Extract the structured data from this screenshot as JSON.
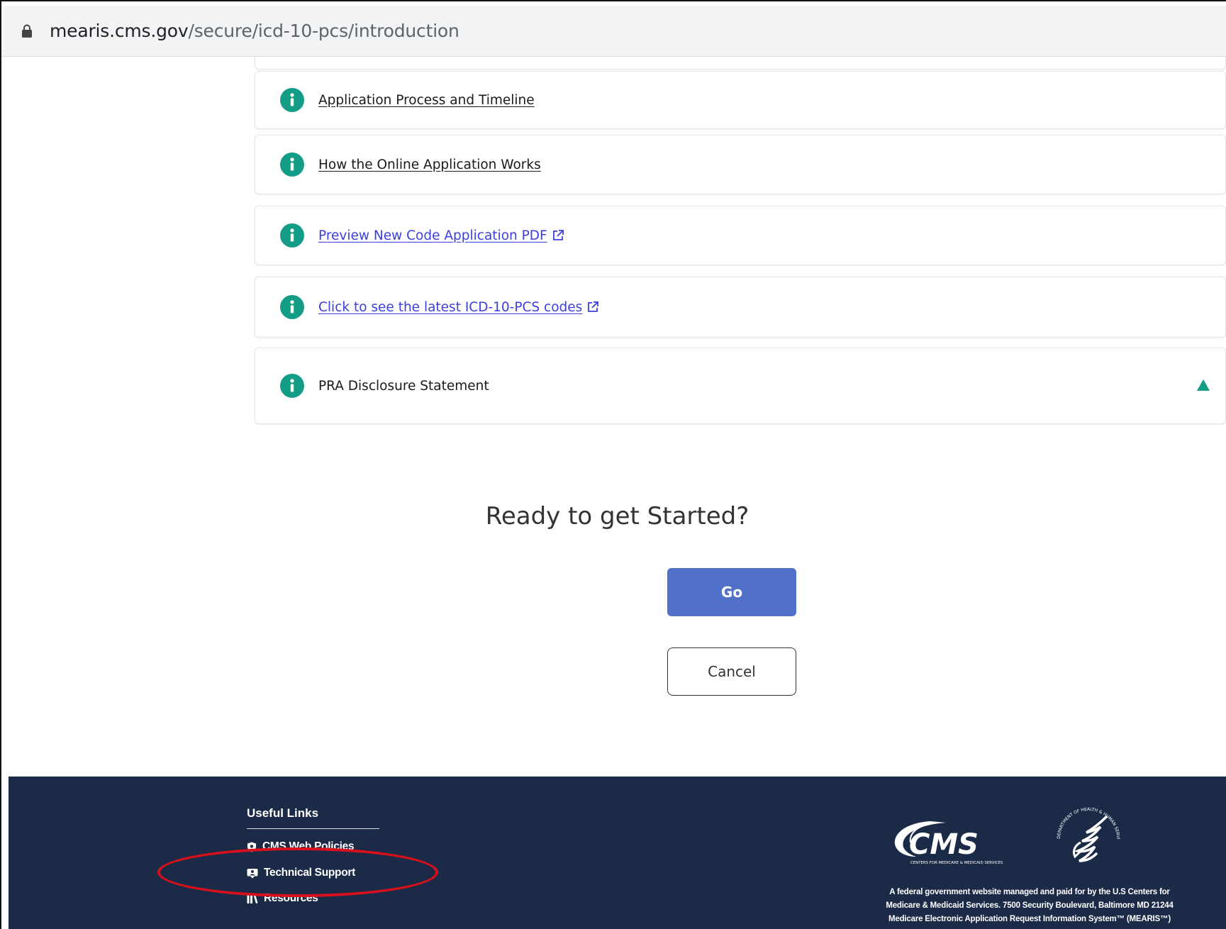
{
  "browser": {
    "url_host": "mearis.cms.gov",
    "url_path": "/secure/icd-10-pcs/introduction"
  },
  "accordion": {
    "items": [
      {
        "label": "Application Process and Timeline"
      },
      {
        "label": "How the Online Application Works"
      },
      {
        "label": "Preview New Code Application PDF"
      },
      {
        "label": "Click to see the latest ICD-10-PCS codes"
      },
      {
        "label": "PRA Disclosure Statement"
      }
    ]
  },
  "cta": {
    "heading": "Ready to get Started?",
    "go_label": "Go",
    "cancel_label": "Cancel"
  },
  "footer": {
    "useful_links_title": "Useful Links",
    "links": [
      {
        "label": "CMS Web Policies",
        "icon": "shield-icon"
      },
      {
        "label": "Technical Support",
        "icon": "support-icon"
      },
      {
        "label": "Resources",
        "icon": "books-icon"
      }
    ],
    "logo_text": "CMS",
    "logo_subtext": "CENTERS FOR MEDICARE & MEDICAID SERVICES",
    "seal_text": "DEPARTMENT OF HEALTH & HUMAN SERVICES USA",
    "disclaimer_lines": [
      "A federal government website managed and paid for by the U.S Centers for",
      "Medicare & Medicaid Services. 7500 Security Boulevard, Baltimore MD 21244",
      "Medicare Electronic Application Request Information System™ (MEARIS™)"
    ]
  },
  "colors": {
    "accent_teal": "#139d86",
    "go_button": "#5171c8",
    "footer_bg": "#1b2a47",
    "link_blue": "#3b3fe0",
    "annotation_red": "#d8101c"
  }
}
